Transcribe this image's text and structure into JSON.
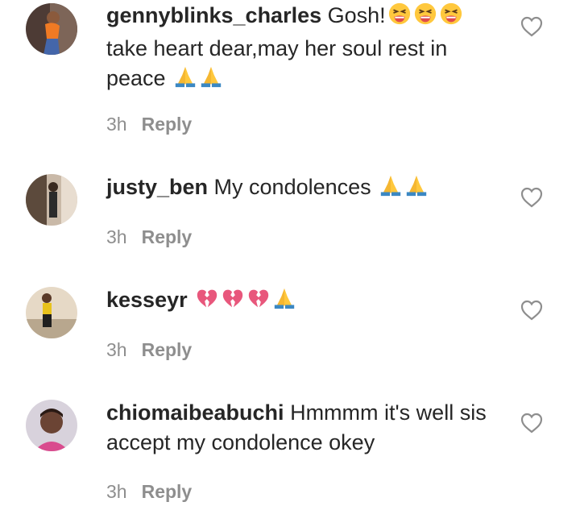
{
  "comments": [
    {
      "username": "gennyblinks_charles",
      "text_before": " Gosh!",
      "emojis_before": [
        "tired-face-emoji",
        "tired-face-emoji",
        "tired-face-emoji"
      ],
      "text_after": "take heart dear,may her soul rest in peace ",
      "emojis_after": [
        "folded-hands-emoji",
        "folded-hands-emoji"
      ],
      "time": "3h",
      "reply_label": "Reply"
    },
    {
      "username": "justy_ben",
      "text_before": " My condolences ",
      "emojis_before": [
        "folded-hands-emoji",
        "folded-hands-emoji"
      ],
      "time": "3h",
      "reply_label": "Reply"
    },
    {
      "username": "kesseyr",
      "text_before": " ",
      "emojis_before": [
        "broken-heart-emoji",
        "broken-heart-emoji",
        "broken-heart-emoji",
        "folded-hands-emoji"
      ],
      "time": "3h",
      "reply_label": "Reply"
    },
    {
      "username": "chiomaibeabuchi",
      "text_before": " Hmmmm it's well sis accept my condolence okey",
      "time": "3h",
      "reply_label": "Reply"
    }
  ],
  "colors": {
    "text": "#262626",
    "meta": "#8e8e8e",
    "heart_outline": "#8e8e8e"
  },
  "icons": {
    "like": "heart-outline-icon"
  }
}
